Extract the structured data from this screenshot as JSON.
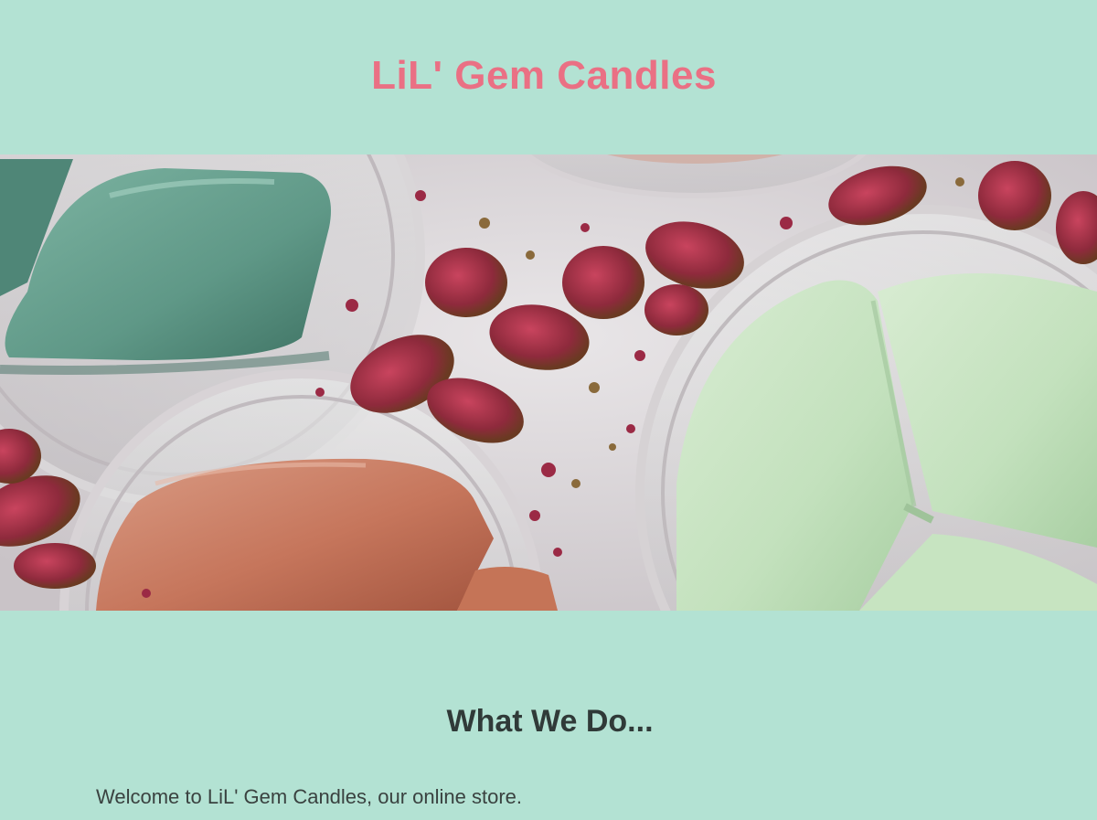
{
  "header": {
    "site_title": "LiL' Gem Candles"
  },
  "hero": {
    "image": "wax-melts-and-dried-rosebuds-photo"
  },
  "main": {
    "section_title": "What We Do...",
    "intro_text": "Welcome to LiL' Gem Candles, our online store."
  },
  "colors": {
    "background": "#b3e2d3",
    "title": "#ea7084",
    "heading": "#303a38",
    "body_text": "#3a4240"
  }
}
